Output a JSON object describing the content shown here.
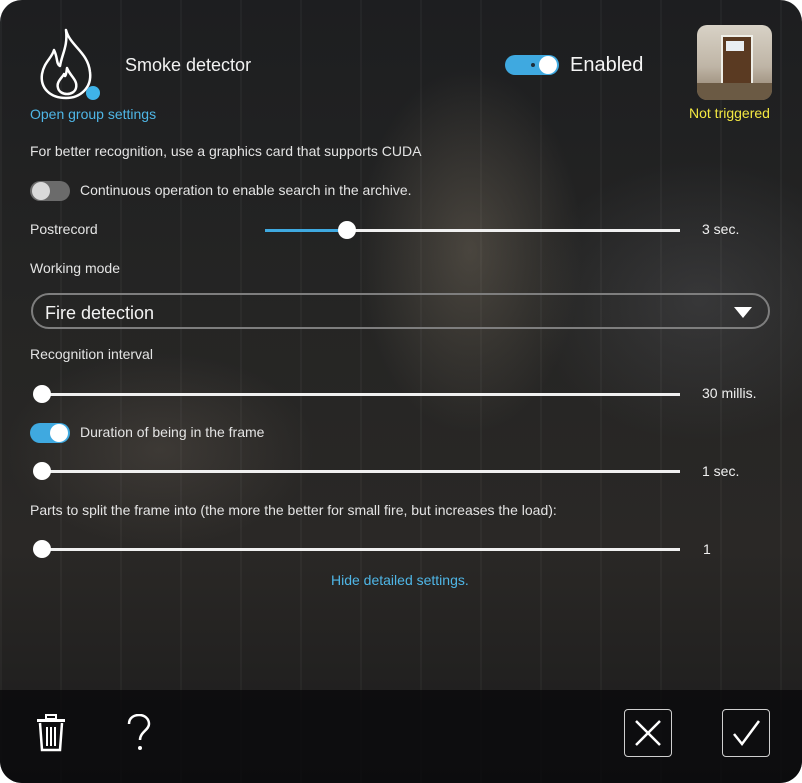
{
  "header": {
    "title": "Smoke detector",
    "group_link": "Open group settings",
    "enabled_label": "Enabled",
    "trigger_status": "Not triggered"
  },
  "settings": {
    "cuda_note": "For better recognition, use a graphics card that supports CUDA",
    "continuous_label": "Continuous operation to enable search in the archive.",
    "continuous_on": false,
    "postrecord": {
      "label": "Postrecord",
      "value_text": "3 sec.",
      "fraction": 0.2
    },
    "working_mode": {
      "label": "Working mode",
      "selected": "Fire detection"
    },
    "recognition_interval": {
      "label": "Recognition interval",
      "value_text": "30 millis.",
      "fraction": 0.0
    },
    "duration": {
      "label": "Duration of being in the frame",
      "on": true,
      "value_text": "1 sec.",
      "fraction": 0.0
    },
    "parts": {
      "label": "Parts to split the frame into (the more the better for small fire, but increases the load):",
      "value_text": "1",
      "fraction": 0.0
    },
    "hide_link": "Hide detailed settings."
  },
  "colors": {
    "accent": "#3fa9e0",
    "warning": "#f4e842",
    "link": "#4fb6e6"
  },
  "icons": [
    "flame-icon",
    "trash-icon",
    "help-icon",
    "close-icon",
    "check-icon"
  ]
}
